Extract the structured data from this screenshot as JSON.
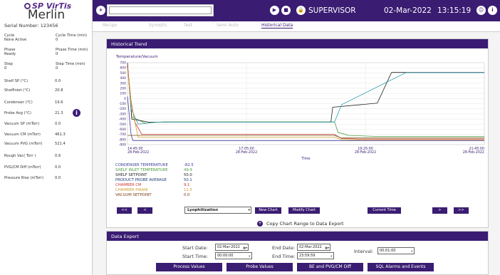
{
  "sidebar": {
    "brand": "SP VirTis",
    "model": "Merlin",
    "serial_label": "Serial Number:",
    "serial": "123456",
    "pairs": [
      {
        "l": "Cycle",
        "lv": "None Active",
        "r": "Cycle Time (min)",
        "rv": "0"
      },
      {
        "l": "Phase",
        "lv": "Ready",
        "r": "Phase Time (min)",
        "rv": "0"
      },
      {
        "l": "Step",
        "lv": "0",
        "r": "Step Time (min)",
        "rv": "0"
      }
    ],
    "readings": [
      {
        "label": "Shelf SP (°C)",
        "value": "0.0"
      },
      {
        "label": "ShelfInlet (°C)",
        "value": "20.8"
      },
      {
        "label": "Condenser (°C)",
        "value": "19.6"
      },
      {
        "label": "Probe Avg (°C)",
        "value": "21.3"
      },
      {
        "label": "Vacuum SP (mTorr)",
        "value": "0.0"
      },
      {
        "label": "Vacuum CM (mTorr)",
        "value": "461.3"
      },
      {
        "label": "Vacuum PVG (mTorr)",
        "value": "521.4"
      },
      {
        "label": "Rough Vac( Torr )",
        "value": "0.6"
      },
      {
        "label": "PVG/CM Diff (mTorr)",
        "value": "0.0"
      },
      {
        "label": "Pressure Rise (mTorr)",
        "value": "0.0"
      }
    ]
  },
  "topbar": {
    "user": "SUPERVISOR",
    "date": "02-Mar-2022",
    "time": "13:15:19"
  },
  "tabs": [
    "Recipe",
    "Synoptic",
    "Test",
    "Semi Auto",
    "Historical Data"
  ],
  "trend": {
    "title": "Historical Trend",
    "chart_data": {
      "type": "line",
      "ylabel": "Temperature/Vacuum",
      "xlabel": "Time",
      "ylim": [
        -900,
        700
      ],
      "yticks": [
        "700",
        "600",
        "500",
        "400",
        "300",
        "200",
        "100",
        "0",
        "-100",
        "-200",
        "-300",
        "-400",
        "-500",
        "-600",
        "-700",
        "-800",
        "-900"
      ],
      "xticks": [
        {
          "time": "14:45:00",
          "date": "28-Feb-2022"
        },
        {
          "time": "17:05:00",
          "date": "28-Feb-2022"
        },
        {
          "time": "19:25:00",
          "date": "28-Feb-2022"
        },
        {
          "time": "21:45:00",
          "date": "28-Feb-2022"
        }
      ],
      "series": [
        {
          "name": "CONDENSER TEMPERATURE",
          "value": "-82.5",
          "color": "#3a3a9a",
          "points": [
            [
              0,
              40
            ],
            [
              0.01,
              -700
            ],
            [
              0.015,
              -820
            ],
            [
              1,
              -820
            ]
          ]
        },
        {
          "name": "SHELF INLET TEMPERATURE",
          "value": "49.9",
          "color": "#4a9a3a",
          "points": [
            [
              0,
              650
            ],
            [
              0.012,
              -360
            ],
            [
              0.05,
              -480
            ],
            [
              0.1,
              -455
            ],
            [
              0.58,
              -455
            ],
            [
              0.59,
              -660
            ],
            [
              0.62,
              -720
            ],
            [
              0.7,
              -740
            ],
            [
              1,
              -740
            ]
          ]
        },
        {
          "name": "SHELF SETPOINT",
          "value": "50.0",
          "color": "#222222",
          "points": [
            [
              0,
              700
            ],
            [
              0.012,
              -400
            ],
            [
              0.06,
              -460
            ],
            [
              0.57,
              -460
            ],
            [
              0.575,
              -170
            ],
            [
              0.7,
              -90
            ],
            [
              0.74,
              510
            ],
            [
              1,
              510
            ]
          ]
        },
        {
          "name": "PRODUCT PROBE AVERAGE",
          "value": "50.1",
          "color": "#2aa0b0",
          "points": [
            [
              0,
              650
            ],
            [
              0.01,
              -200
            ],
            [
              0.03,
              -500
            ],
            [
              0.08,
              -460
            ],
            [
              0.58,
              -460
            ],
            [
              0.6,
              -120
            ],
            [
              0.78,
              505
            ],
            [
              1,
              505
            ]
          ]
        },
        {
          "name": "CHAMBER CM",
          "value": "9.1",
          "color": "#cc3333",
          "points": [
            [
              0,
              650
            ],
            [
              0.01,
              -50
            ],
            [
              0.02,
              -450
            ],
            [
              0.04,
              -700
            ],
            [
              0.58,
              -700
            ],
            [
              0.6,
              -780
            ],
            [
              0.65,
              -790
            ],
            [
              1,
              -790
            ]
          ]
        },
        {
          "name": "CHAMBER PIRANI",
          "value": "11.5",
          "color": "#d09a30",
          "points": [
            [
              0,
              600
            ],
            [
              0.01,
              -100
            ],
            [
              0.03,
              -760
            ],
            [
              0.58,
              -760
            ],
            [
              0.6,
              -800
            ],
            [
              0.65,
              -810
            ],
            [
              1,
              -810
            ]
          ]
        },
        {
          "name": "VACUUM SETPOINT",
          "value": "0.0",
          "color": "#7a5a20",
          "points": [
            [
              0,
              -720
            ],
            [
              0.58,
              -720
            ],
            [
              0.6,
              -770
            ],
            [
              1,
              -770
            ]
          ]
        }
      ]
    },
    "controls": {
      "first": "<<",
      "prev": "<",
      "preset": "Lyophilization",
      "new_chart": "New Chart",
      "modify_chart": "Modify Chart",
      "current_time": "Current Time",
      "next": ">",
      "last": ">>"
    },
    "copy_link": "Copy Chart Range to Data Export"
  },
  "export": {
    "title": "Data Export",
    "start_date_label": "Start Date:",
    "start_date": "02-Mar-2022",
    "start_time_label": "Start Time:",
    "start_time": "00:00:00",
    "end_date_label": "End Date:",
    "end_date": "02-Mar-2022",
    "end_time_label": "End Time:",
    "end_time": "23:59:59",
    "interval_label": "Interval:",
    "interval": "00:01:00",
    "buttons": [
      "Process Values",
      "Probe Values",
      "BE and PVG/CM Diff",
      "SQL Alarms and Events"
    ]
  }
}
